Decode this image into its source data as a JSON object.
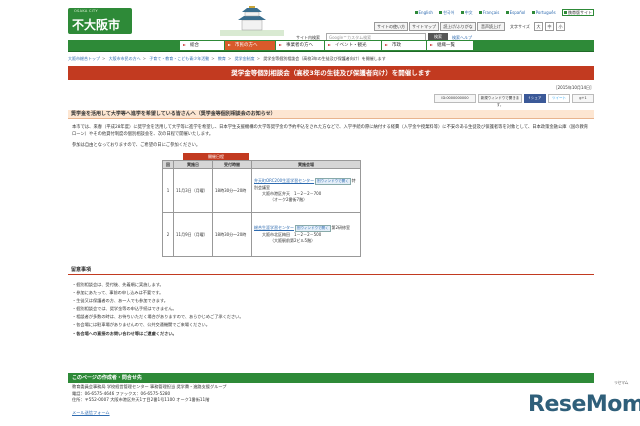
{
  "header": {
    "logo_sub": "OSAKA CITY",
    "logo_main": "不大阪市",
    "langs": [
      "English",
      "한국어",
      "中文",
      "Français",
      "Español",
      "Português"
    ],
    "mobile_site": "携帯版サイト",
    "menu_buttons": [
      "サイトの使い方",
      "サイトマップ",
      "読上げ/ふりがな",
      "音声読上げ"
    ],
    "font_size_label": "文字サイズ",
    "font_sizes": [
      "大",
      "中",
      "小"
    ],
    "search_label": "サイト内検索",
    "search_placeholder": "Google™カスタム検索",
    "search_button": "検索",
    "search_help": "検索ヘルプ"
  },
  "gnav": [
    "総合",
    "市民の方へ",
    "事業者の方へ",
    "イベント・観光",
    "市政",
    "組織一覧"
  ],
  "breadcrumb": [
    "大阪市総合トップ",
    "大阪市市民の方へ",
    "子育て・教育・こども青少年活動",
    "教育",
    "奨学金制度",
    "奨学金等個別相談会（高校3年の生徒及び保護者向け）を開催します"
  ],
  "page": {
    "title": "奨学金等個別相談会（高校3年の生徒及び保護者向け）を開催します",
    "date": "［2015年10月14日］",
    "share": {
      "id_link": "ID:0000000000",
      "new_window": "新規ウィンドウで開きます。",
      "facebook": "f シェア",
      "twitter": "ツイート",
      "google": "g+1"
    },
    "section_title": "奨学金を活用して大学等へ進学を希望している皆さんへ（奨学金等個別相談会のお知らせ）",
    "para1": "本市では、来春（平成28年度）に奨学金を活用して大学等に進学を希望し、日本学生支援機構の大学等奨学金の予約申込をされた方などで、入学手続の際に納付する経費（入学金や授業料等）に不安のある生徒及び保護者等を対象として、日本政策金融公庫（国の教育ローン）やその他貸付制度の個別相談会を、次の日程で開催いたします。",
    "para2": "参加は自由となっておりますので、ご希望の日にご参加ください。"
  },
  "events": {
    "caption": "開催日程",
    "headers": [
      "回",
      "実施日",
      "受付時間",
      "実施会場"
    ],
    "rows": [
      {
        "no": "1",
        "date": "11月3日（月曜）",
        "time": "18時30分～20時",
        "venue_link": "弁天町ORC200生涯学習センター",
        "window_btn": "別ウィンドウで開く",
        "venue_room": "特別会議室",
        "address": "大阪市港区弁天　1－2－2－700",
        "note": "（オーク2番街7階）"
      },
      {
        "no": "2",
        "date": "11月9日（月曜）",
        "time": "18時30分～20時",
        "venue_link": "総合生涯学習センター",
        "window_btn": "別ウィンドウで開く",
        "venue_room": "第2研修室",
        "address": "大阪市北区梅田　1－2－2－500",
        "note": "（大阪駅前第2ビル5階）"
      }
    ]
  },
  "notes": {
    "title": "留意事項",
    "items": [
      "個別相談会は、受付後、先着順に実施します。",
      "参加にあたって、事前の申し込みは不要です。",
      "生徒又は保護者の方、あ～人でも参加できます。",
      "個別相談会では、奨学金等の申込手続はできません。",
      "相談者が多数の時は、お待ちいただく場合がありますので、あらかじめご了承ください。",
      "各会場には駐車場がありませんので、公共交通機関でご来場ください。",
      "各会場への直接のお問い合わせ等はご遠慮ください。"
    ]
  },
  "contact": {
    "title": "このページの作成者・問合せ先",
    "lines": [
      "教育委員会事務局 学校経営管理センター 事務管理担当 奨学費・進路支援グループ",
      "電話：06-6575-4646 ファックス：06-6575-5280",
      "住所：〒552-0007 大阪市港区弁天1丁目2番1号1100 オーク1番街11階"
    ],
    "mail": "メール送信フォーム"
  },
  "watermark": {
    "brand": "ReseMom",
    "tag": "リセマム"
  }
}
